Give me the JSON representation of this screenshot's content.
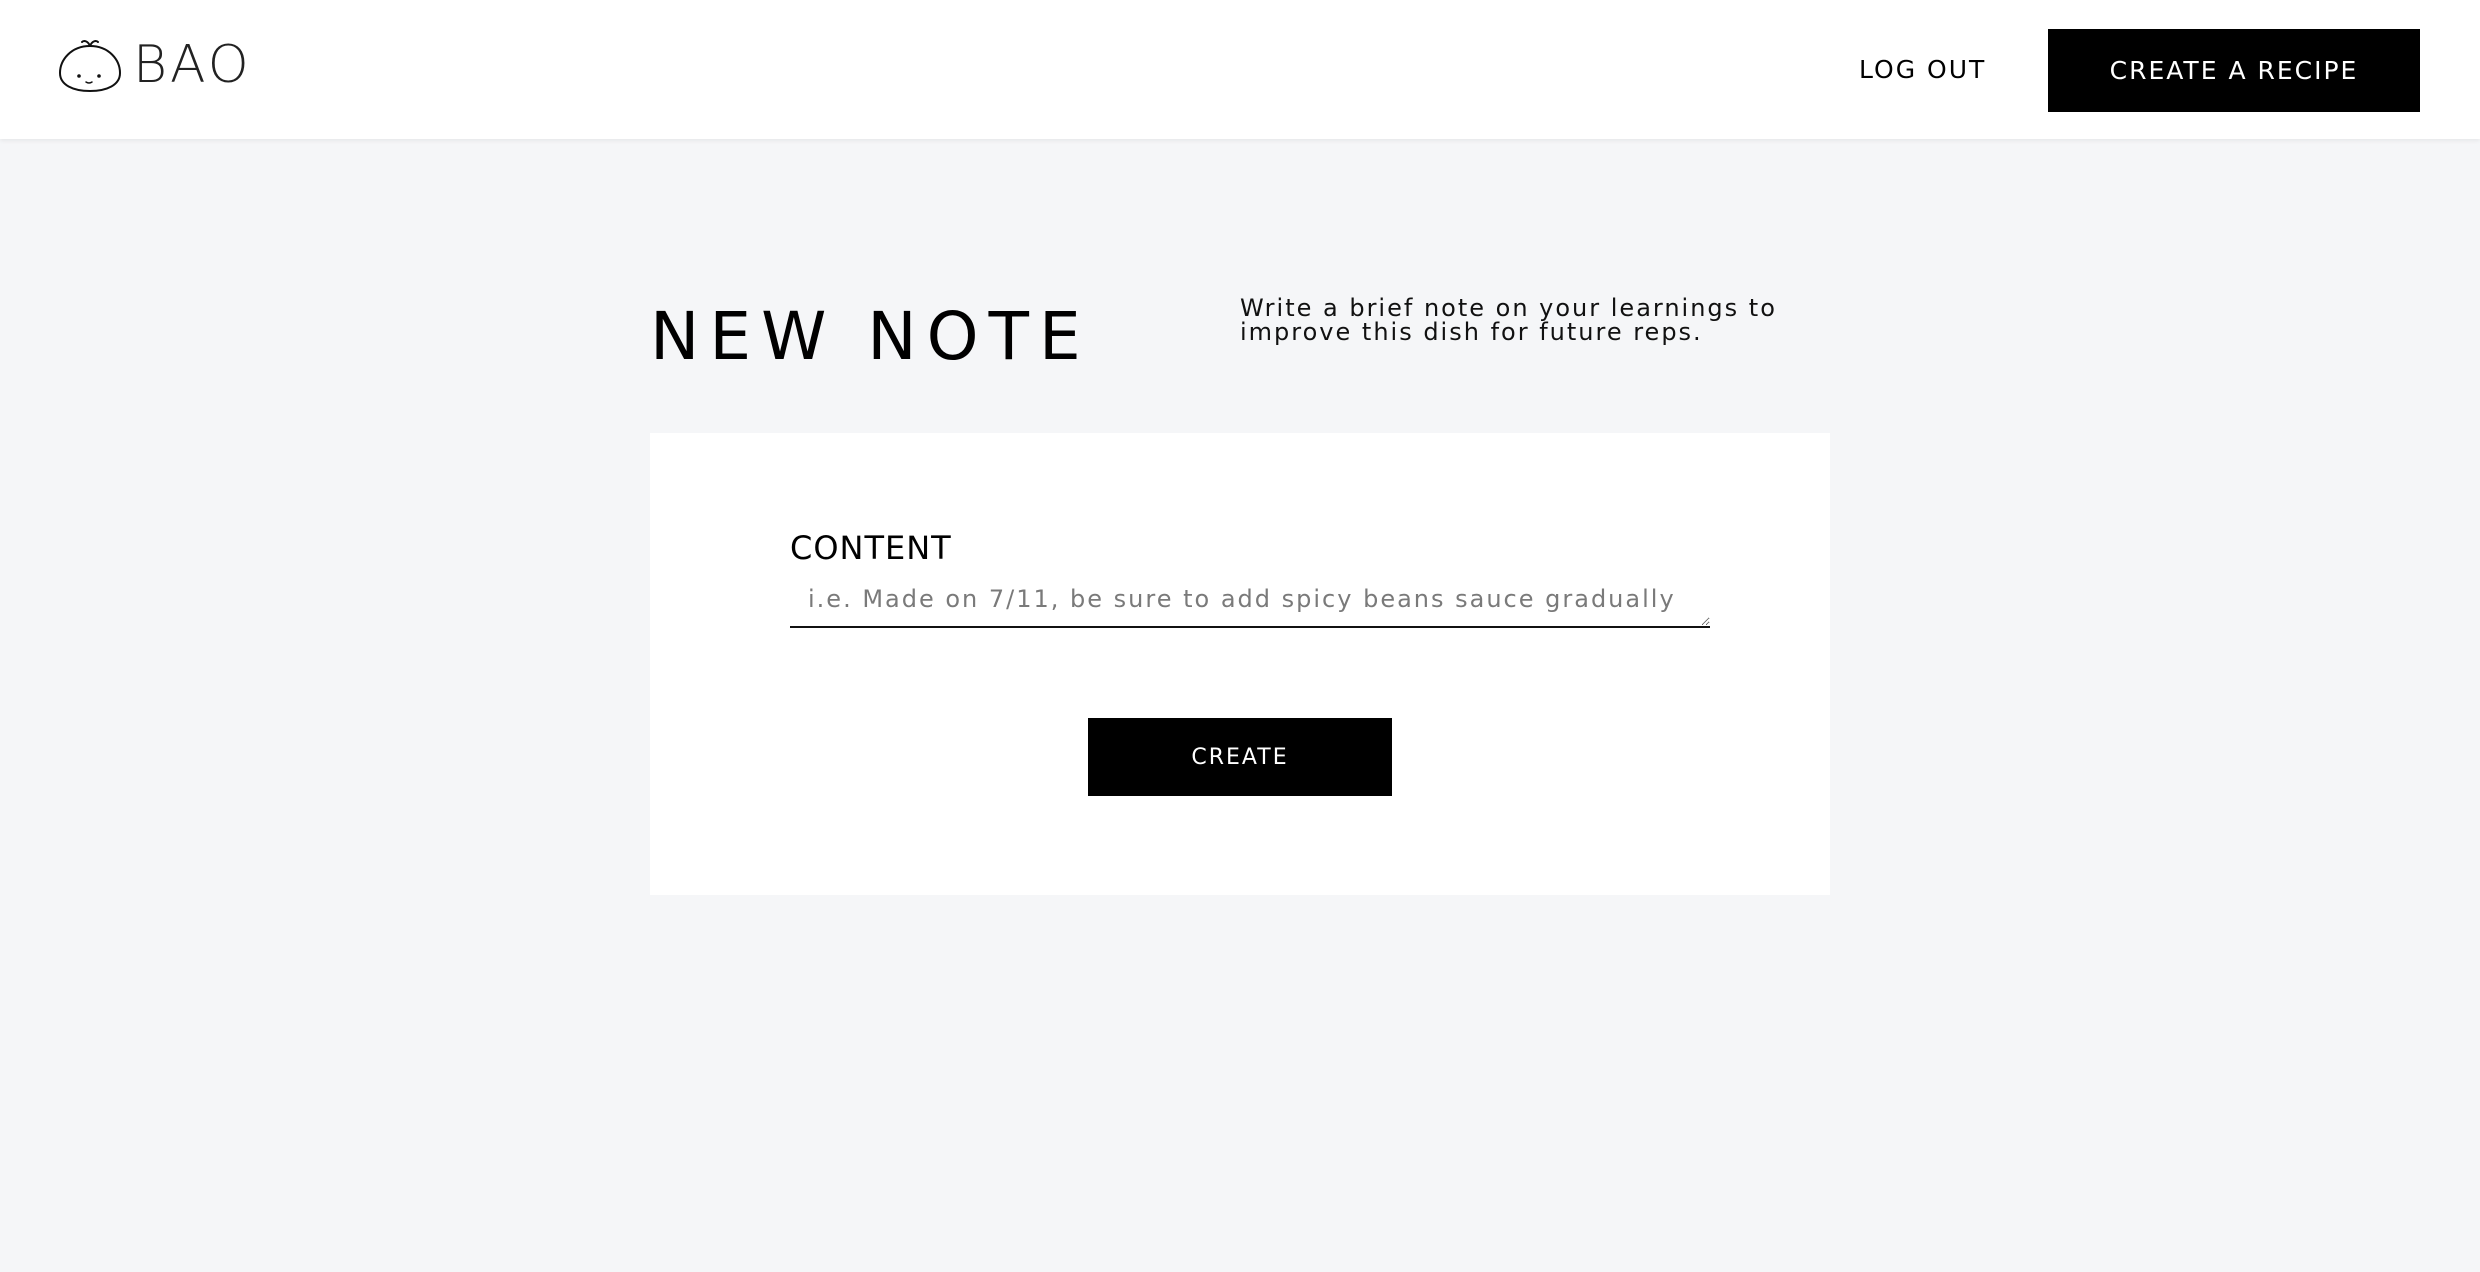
{
  "header": {
    "brand": "BAO",
    "logo_icon": "bao-bun-icon",
    "logout_label": "LOG OUT",
    "create_recipe_label": "CREATE A RECIPE"
  },
  "page": {
    "title": "NEW NOTE",
    "description": "Write a brief note on your learnings to improve this dish for future reps."
  },
  "form": {
    "content_label": "CONTENT",
    "content_placeholder": "i.e. Made on 7/11, be sure to add spicy beans sauce gradually",
    "content_value": "",
    "submit_label": "CREATE"
  },
  "colors": {
    "background": "#f5f6f8",
    "surface": "#ffffff",
    "primary": "#000000",
    "primary_text": "#ffffff"
  }
}
